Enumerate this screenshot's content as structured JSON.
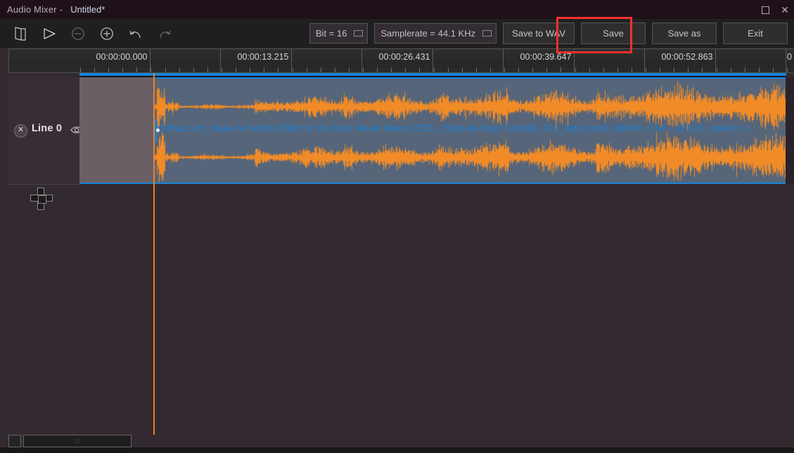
{
  "window": {
    "app_title": "Audio Mixer -",
    "file_name": "Untitled*",
    "maximize_icon": "maximize-icon",
    "close_icon": "close-icon"
  },
  "toolbar": {
    "icons": [
      {
        "name": "open-file-icon",
        "label": "Open"
      },
      {
        "name": "play-icon",
        "label": "Play"
      },
      {
        "name": "zoom-out-icon",
        "label": "Zoom out"
      },
      {
        "name": "zoom-in-icon",
        "label": "Zoom in"
      },
      {
        "name": "undo-icon",
        "label": "Undo"
      },
      {
        "name": "redo-icon",
        "label": "Redo"
      }
    ],
    "bit_combo": {
      "label": "Bit = 16",
      "arrow_icon": "dropdown-icon"
    },
    "samplerate_combo": {
      "label": "Samplerate = 44.1 KHz",
      "arrow_icon": "dropdown-icon"
    },
    "save_to_wav_label": "Save to WAV",
    "save_label": "Save",
    "save_as_label": "Save as",
    "exit_label": "Exit",
    "highlight_color": "#fd2f2f",
    "highlight_target": "Save to WAV"
  },
  "ruler": {
    "labels": [
      "00:00:00.000",
      "00:00:13.215",
      "00:00:26.431",
      "00:00:39.647",
      "00:00:52.863",
      "0"
    ]
  },
  "track": {
    "close_icon": "close-track-icon",
    "name": "Line 0",
    "eye_icon": "visibility-eye-icon",
    "add_track_icon": "add-track-plus-icon",
    "clip": {
      "label": "Ontiva.com_Make A Particle Effect in YouTube Movie Maker 2020_ (Step-by-Step Tutorial) (192_kbps).mp3  (48KHz, 0.00 - 419.20, speed x 1",
      "waveform_color": "#f08b28",
      "background_color": "#566579",
      "text_color": "#1a7fd4",
      "border_color": "#1683d8"
    }
  },
  "playhead": {
    "color": "#ef7f1a"
  },
  "scrollbar": {
    "grip": "⦙⦙⦙",
    "left_button_icon": "scroll-left-icon"
  }
}
